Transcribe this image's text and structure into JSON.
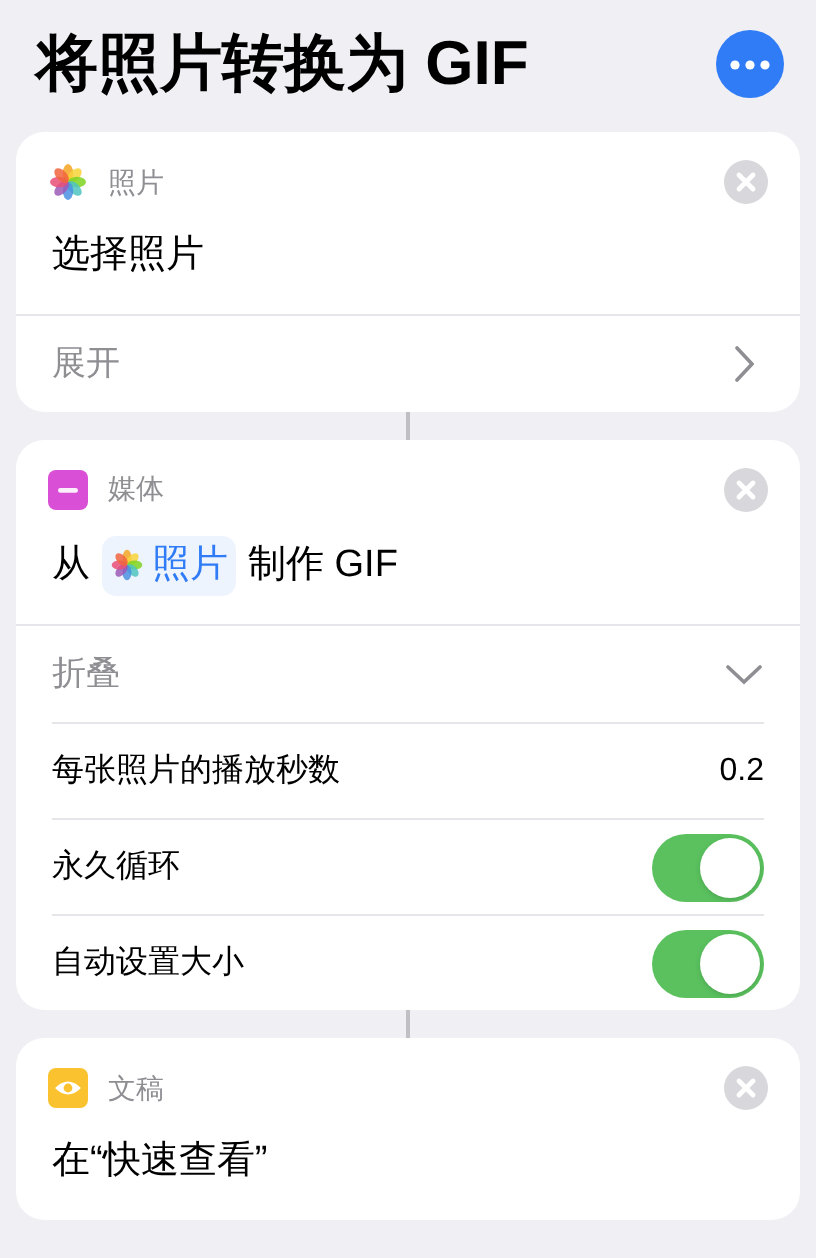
{
  "title": "将照片转换为 GIF",
  "cards": [
    {
      "kind": "photos",
      "category": "照片",
      "action": [
        {
          "kind": "text",
          "text": "选择照片"
        }
      ],
      "footer": {
        "label": "展开",
        "expanded": false
      }
    },
    {
      "kind": "media",
      "category": "媒体",
      "action": [
        {
          "kind": "text",
          "text": "从"
        },
        {
          "kind": "token",
          "text": "照片"
        },
        {
          "kind": "text",
          "text": "制作 GIF"
        }
      ],
      "footer": {
        "label": "折叠",
        "expanded": true
      },
      "params": [
        {
          "kind": "value",
          "label": "每张照片的播放秒数",
          "value": "0.2"
        },
        {
          "kind": "switch",
          "label": "永久循环",
          "on": true
        },
        {
          "kind": "switch",
          "label": "自动设置大小",
          "on": true
        }
      ]
    },
    {
      "kind": "eye",
      "category": "文稿",
      "action": [
        {
          "kind": "text",
          "text": "在“快速查看”"
        }
      ]
    }
  ]
}
